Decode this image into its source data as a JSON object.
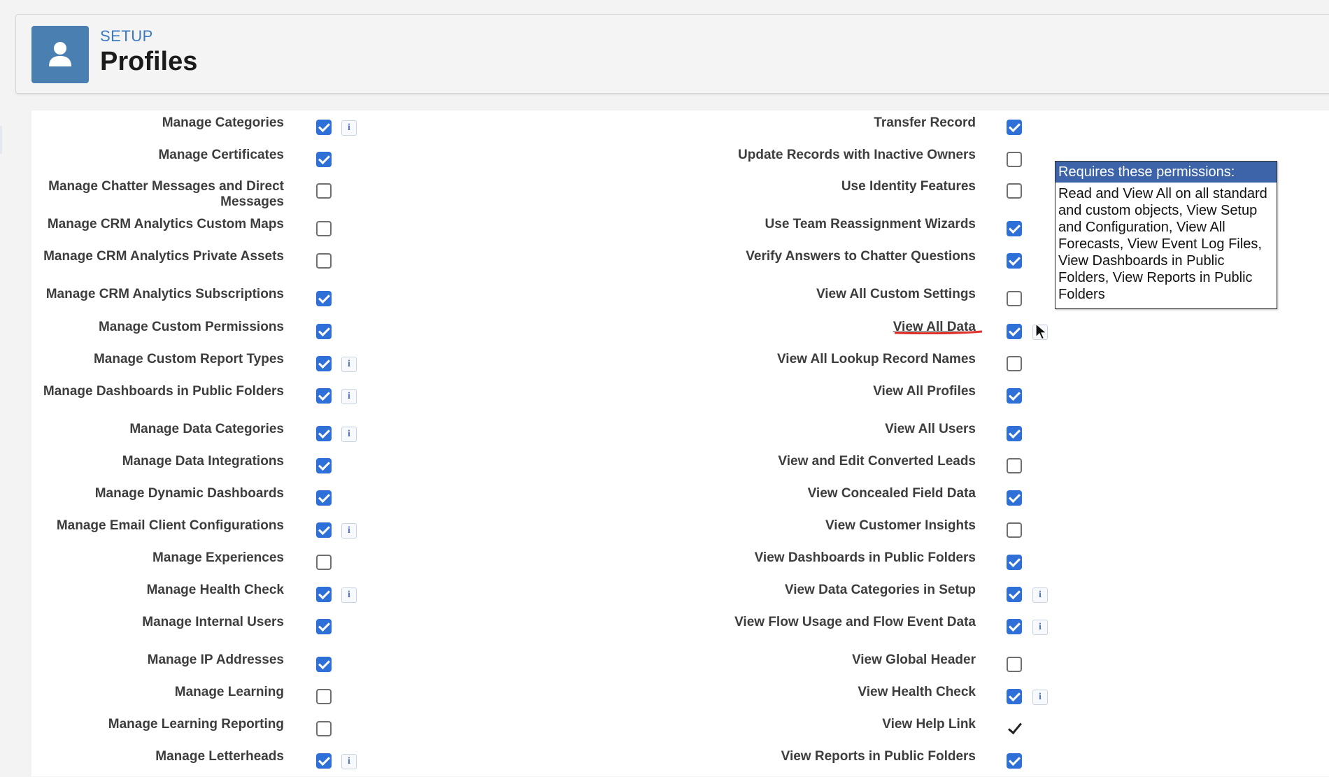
{
  "header": {
    "eyebrow": "SETUP",
    "title": "Profiles",
    "icon": "user-icon",
    "accent": "#4a7fb1"
  },
  "left_column": [
    {
      "label": "Manage Categories",
      "checked": true,
      "info": true
    },
    {
      "label": "Manage Certificates",
      "checked": true,
      "info": false
    },
    {
      "label": "Manage Chatter Messages and Direct Messages",
      "checked": false,
      "info": false
    },
    {
      "label": "Manage CRM Analytics Custom Maps",
      "checked": false,
      "info": false
    },
    {
      "label": "Manage CRM Analytics Private Assets",
      "checked": false,
      "info": false
    },
    {
      "label": "Manage CRM Analytics Subscriptions",
      "checked": true,
      "info": false
    },
    {
      "label": "Manage Custom Permissions",
      "checked": true,
      "info": false
    },
    {
      "label": "Manage Custom Report Types",
      "checked": true,
      "info": true
    },
    {
      "label": "Manage Dashboards in Public Folders",
      "checked": true,
      "info": true
    },
    {
      "label": "Manage Data Categories",
      "checked": true,
      "info": true
    },
    {
      "label": "Manage Data Integrations",
      "checked": true,
      "info": false
    },
    {
      "label": "Manage Dynamic Dashboards",
      "checked": true,
      "info": false
    },
    {
      "label": "Manage Email Client Configurations",
      "checked": true,
      "info": true
    },
    {
      "label": "Manage Experiences",
      "checked": false,
      "info": false
    },
    {
      "label": "Manage Health Check",
      "checked": true,
      "info": true
    },
    {
      "label": "Manage Internal Users",
      "checked": true,
      "info": false
    },
    {
      "label": "Manage IP Addresses",
      "checked": true,
      "info": false
    },
    {
      "label": "Manage Learning",
      "checked": false,
      "info": false
    },
    {
      "label": "Manage Learning Reporting",
      "checked": false,
      "info": false
    },
    {
      "label": "Manage Letterheads",
      "checked": true,
      "info": true
    }
  ],
  "right_column": [
    {
      "label": "Transfer Record",
      "checked": true,
      "info": false
    },
    {
      "label": "Update Records with Inactive Owners",
      "checked": false,
      "info": false
    },
    {
      "label": "Use Identity Features",
      "checked": false,
      "info": false
    },
    {
      "label": "Use Team Reassignment Wizards",
      "checked": true,
      "info": false
    },
    {
      "label": "Verify Answers to Chatter Questions",
      "checked": true,
      "info": false
    },
    {
      "label": "View All Custom Settings",
      "checked": false,
      "info": false
    },
    {
      "label": "View All Data",
      "checked": true,
      "info": true,
      "underlined": true
    },
    {
      "label": "View All Lookup Record Names",
      "checked": false,
      "info": false
    },
    {
      "label": "View All Profiles",
      "checked": true,
      "info": false
    },
    {
      "label": "View All Users",
      "checked": true,
      "info": false
    },
    {
      "label": "View and Edit Converted Leads",
      "checked": false,
      "info": false
    },
    {
      "label": "View Concealed Field Data",
      "checked": true,
      "info": false
    },
    {
      "label": "View Customer Insights",
      "checked": false,
      "info": false
    },
    {
      "label": "View Dashboards in Public Folders",
      "checked": true,
      "info": false
    },
    {
      "label": "View Data Categories in Setup",
      "checked": true,
      "info": true
    },
    {
      "label": "View Flow Usage and Flow Event Data",
      "checked": true,
      "info": true
    },
    {
      "label": "View Global Header",
      "checked": false,
      "info": false
    },
    {
      "label": "View Health Check",
      "checked": true,
      "info": true
    },
    {
      "label": "View Help Link",
      "checked": true,
      "info": false,
      "plain_check": true
    },
    {
      "label": "View Reports in Public Folders",
      "checked": true,
      "info": false
    }
  ],
  "info_glyph": "i",
  "tooltip": {
    "title": "Requires these permissions:",
    "body": "Read and View All on all standard and custom objects, View Setup and Configuration, View All Forecasts, View Event Log Files, View Dashboards in Public Folders, View Reports in Public Folders"
  },
  "colors": {
    "checkbox_on": "#2f6fd8",
    "tooltip_header": "#3d63a8",
    "annotation": "#e0302a"
  }
}
